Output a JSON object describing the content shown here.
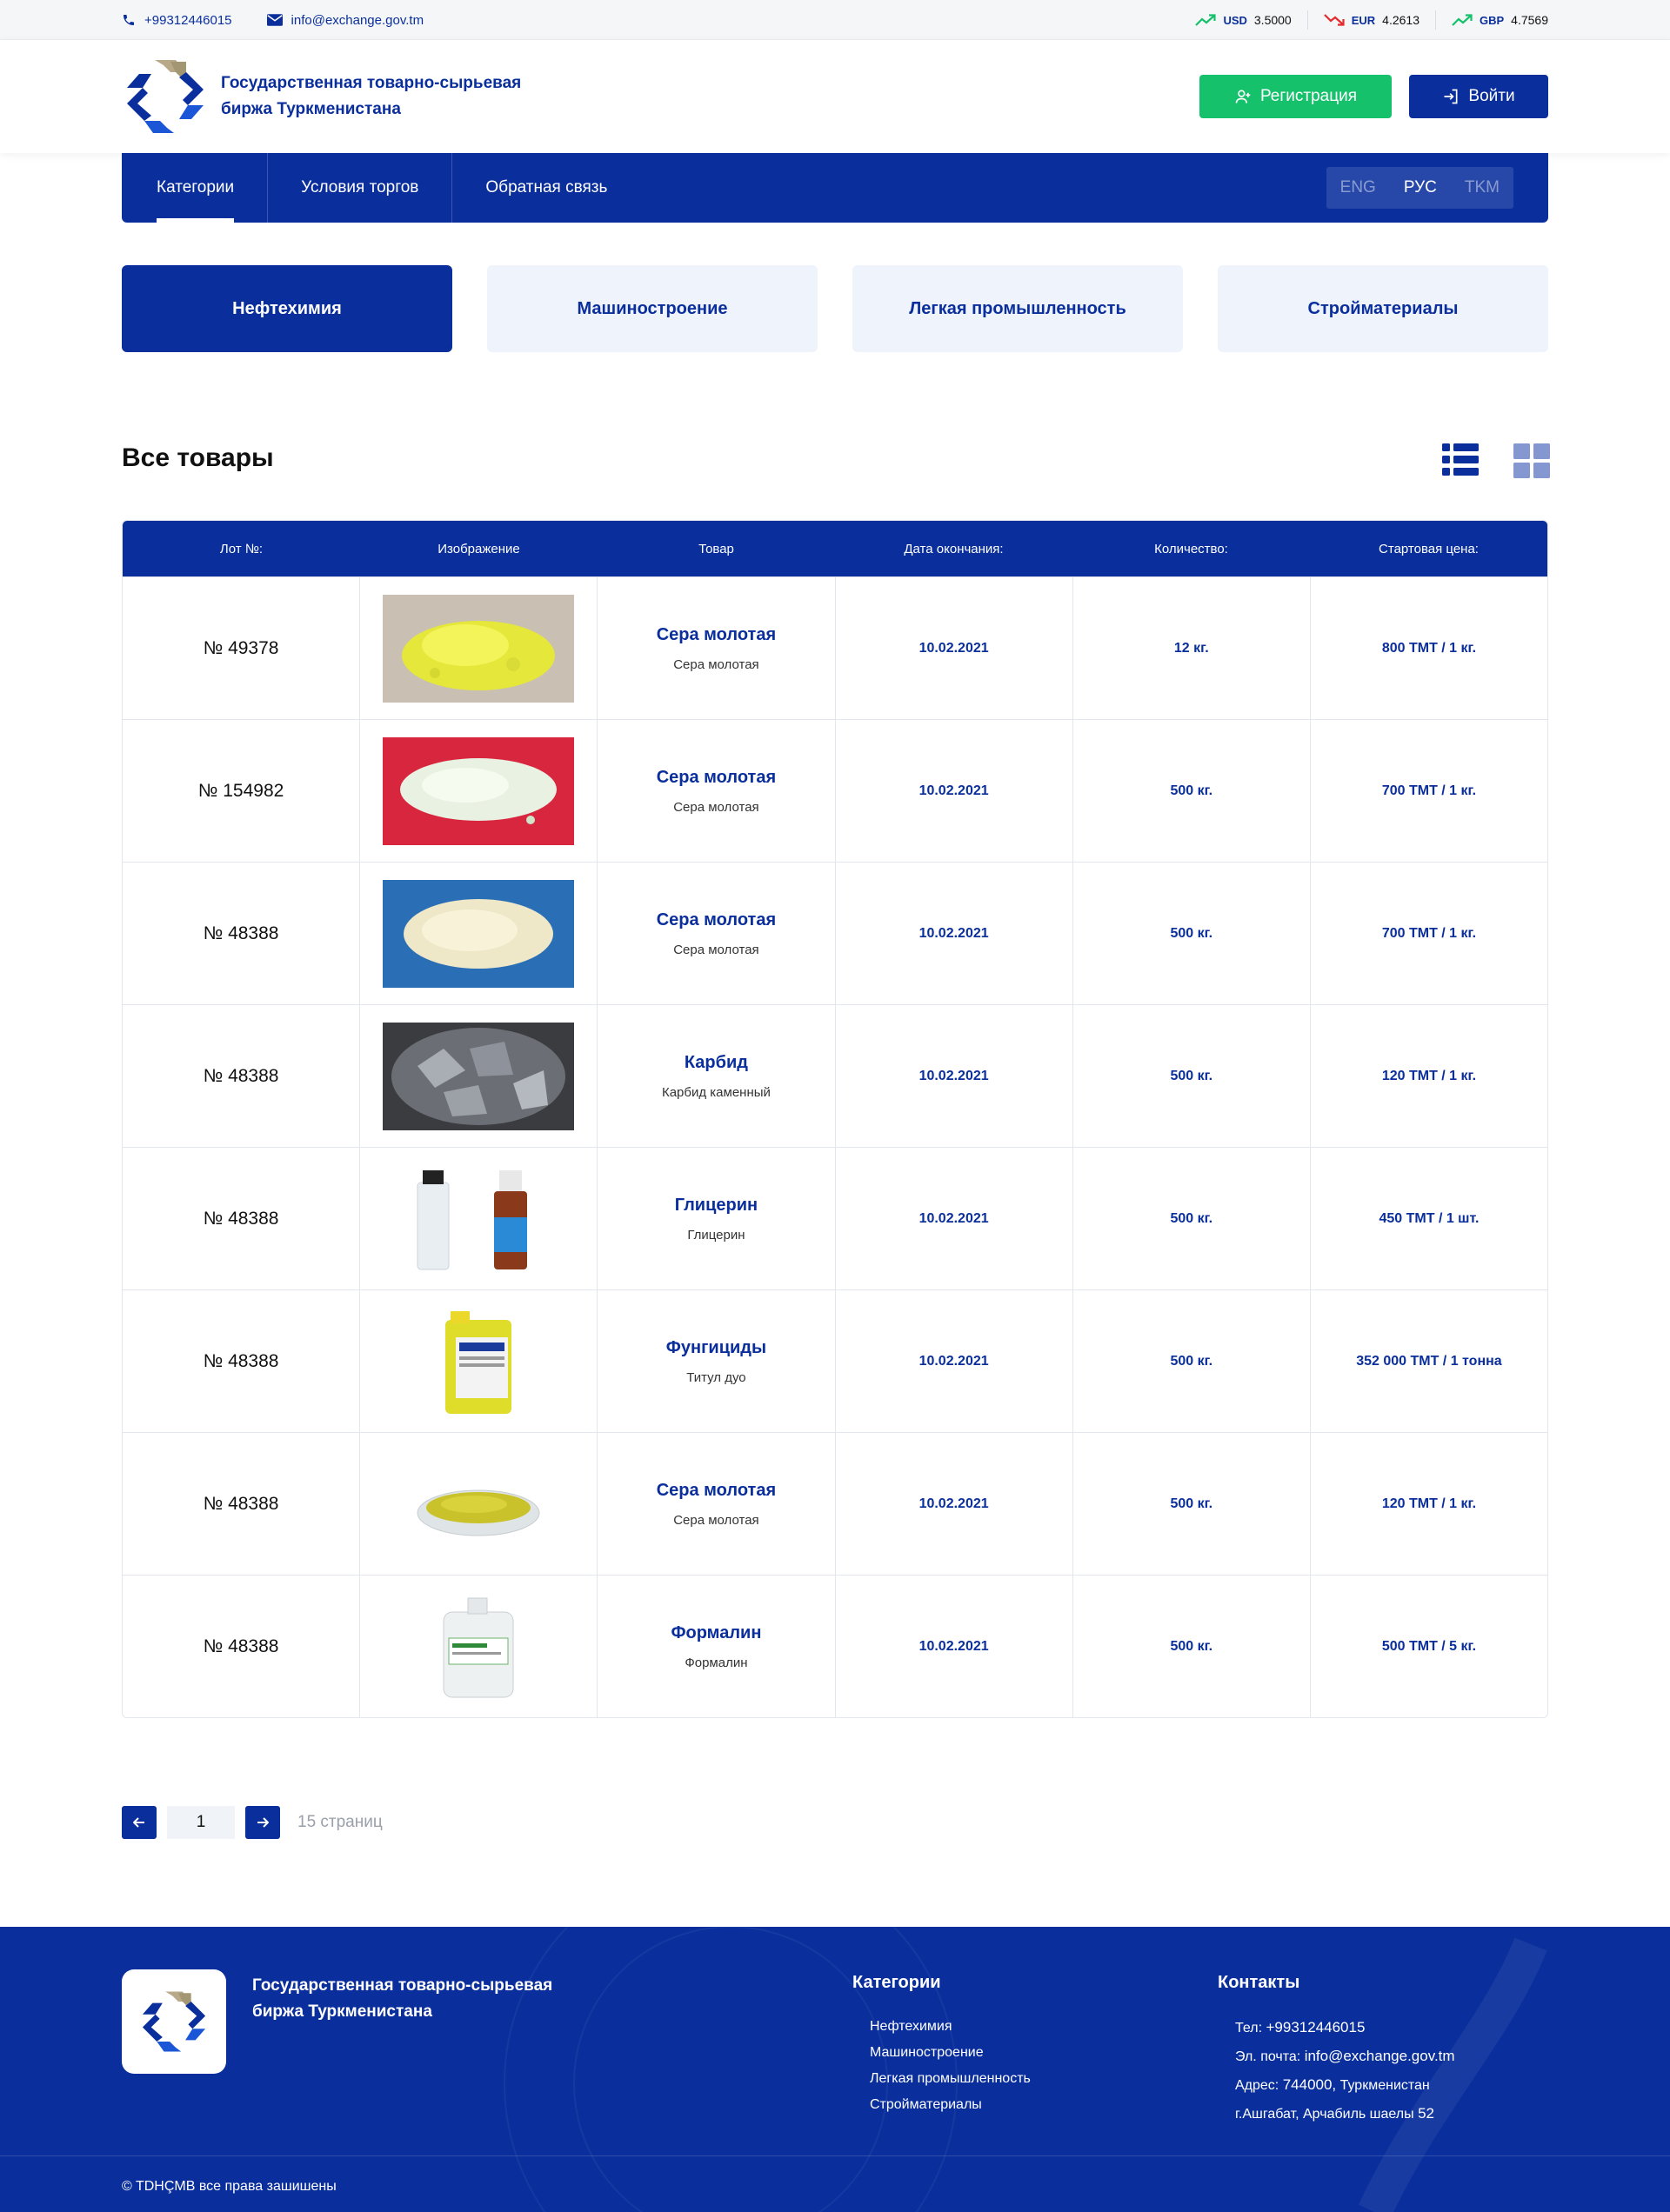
{
  "topbar": {
    "phone": "+99312446015",
    "email": "info@exchange.gov.tm",
    "rates": [
      {
        "currency": "USD",
        "value": "3.5000",
        "trend": "up",
        "color": "#16c16c"
      },
      {
        "currency": "EUR",
        "value": "4.2613",
        "trend": "down",
        "color": "#e52b2b"
      },
      {
        "currency": "GBP",
        "value": "4.7569",
        "trend": "up",
        "color": "#16c16c"
      }
    ]
  },
  "header": {
    "brand": "Государственная товарно-сырьевая биржа Туркменистана",
    "register_label": "Регистрация",
    "login_label": "Войти"
  },
  "nav": {
    "items": [
      {
        "label": "Категории",
        "active": true
      },
      {
        "label": "Условия торгов",
        "active": false
      },
      {
        "label": "Обратная связь",
        "active": false
      }
    ],
    "languages": [
      {
        "label": "ENG",
        "active": false
      },
      {
        "label": "РУС",
        "active": true
      },
      {
        "label": "TKM",
        "active": false
      }
    ]
  },
  "categories": [
    {
      "label": "Нефтехимия",
      "active": true
    },
    {
      "label": "Машиностроение",
      "active": false
    },
    {
      "label": "Легкая промышленность",
      "active": false
    },
    {
      "label": "Стройматериалы",
      "active": false
    }
  ],
  "section": {
    "title": "Все товары"
  },
  "table": {
    "headers": [
      "Лот №:",
      "Изображение",
      "Товар",
      "Дата окончания:",
      "Количество:",
      "Стартовая цена:"
    ],
    "rows": [
      {
        "lot": "№ 49378",
        "image": "sulfur-powder-yellow",
        "name": "Сера молотая",
        "sub": "Сера молотая",
        "date": "10.02.2021",
        "qty": "12 кг.",
        "price": "800 ТМТ / 1 кг."
      },
      {
        "lot": "№ 154982",
        "image": "sulfur-powder-red-bg",
        "name": "Сера молотая",
        "sub": "Сера молотая",
        "date": "10.02.2021",
        "qty": "500 кг.",
        "price": "700 ТМТ / 1 кг."
      },
      {
        "lot": "№ 48388",
        "image": "sulfur-powder-blue-bg",
        "name": "Сера молотая",
        "sub": "Сера молотая",
        "date": "10.02.2021",
        "qty": "500 кг.",
        "price": "700 ТМТ / 1 кг."
      },
      {
        "lot": "№ 48388",
        "image": "carbide-stones",
        "name": "Карбид",
        "sub": "Карбид каменный",
        "date": "10.02.2021",
        "qty": "500 кг.",
        "price": "120 ТМТ / 1 кг."
      },
      {
        "lot": "№ 48388",
        "image": "glycerin-bottles",
        "name": "Глицерин",
        "sub": "Глицерин",
        "date": "10.02.2021",
        "qty": "500 кг.",
        "price": "450 ТМТ / 1 шт."
      },
      {
        "lot": "№ 48388",
        "image": "fungicide-canister",
        "name": "Фунгициды",
        "sub": "Титул дуо",
        "date": "10.02.2021",
        "qty": "500 кг.",
        "price": "352 000 ТМТ / 1 тонна"
      },
      {
        "lot": "№ 48388",
        "image": "sulfur-petri-dish",
        "name": "Сера молотая",
        "sub": "Сера молотая",
        "date": "10.02.2021",
        "qty": "500 кг.",
        "price": "120 ТМТ / 1 кг."
      },
      {
        "lot": "№ 48388",
        "image": "formalin-jug",
        "name": "Формалин",
        "sub": "Формалин",
        "date": "10.02.2021",
        "qty": "500 кг.",
        "price": "500 ТМТ / 5 кг."
      }
    ]
  },
  "pagination": {
    "current": "1",
    "total_label": "15 страниц"
  },
  "footer": {
    "brand": "Государственная товарно-сырьевая биржа Туркменистана",
    "categories_title": "Категории",
    "categories": [
      "Нефтехимия",
      "Машиностроение",
      "Легкая промышленность",
      "Стройматериалы"
    ],
    "contacts_title": "Контакты",
    "phone_label": "Тел:",
    "phone": "+99312446015",
    "email_label": "Эл. почта:",
    "email": "info@exchange.gov.tm",
    "address_label": "Адрес:",
    "address_code": "744000,",
    "address_line1_rest": "Туркменистан",
    "address_line2": "г.Ашгабат, Арчабиль шаелы",
    "address_number": "52",
    "copyright": "© TDHÇMB все права зашишены"
  },
  "colors": {
    "brand_blue": "#0a2f9c",
    "green": "#16c16c",
    "light_tab": "#eef3fc",
    "red": "#e52b2b"
  }
}
